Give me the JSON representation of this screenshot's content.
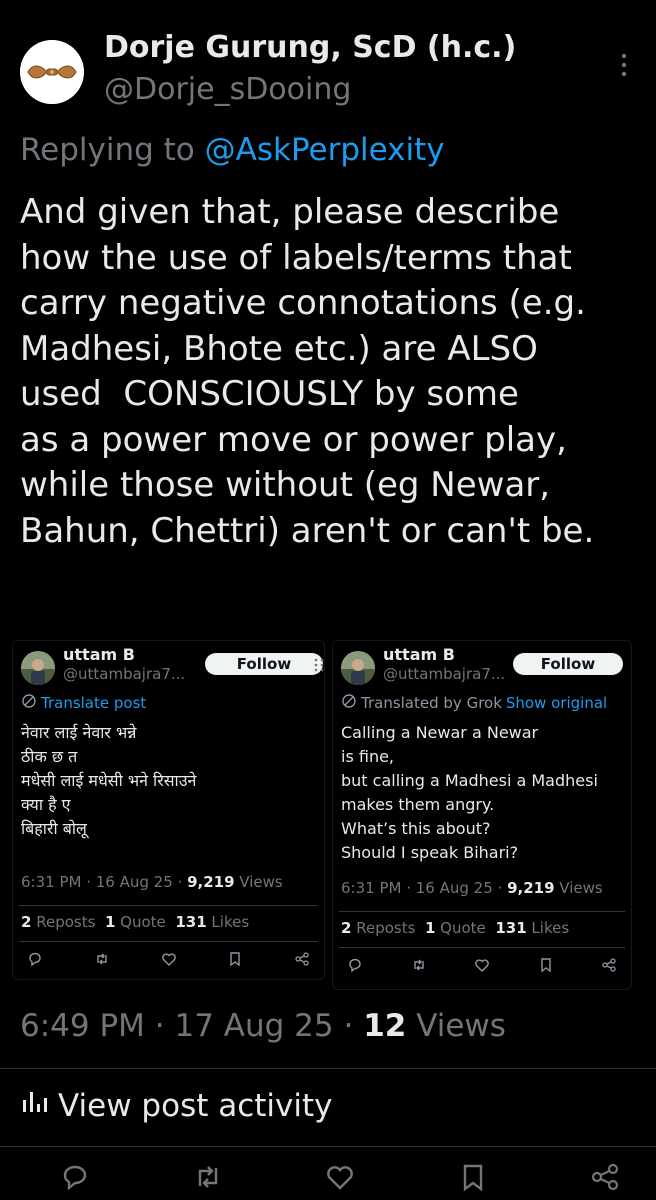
{
  "post": {
    "author_name": "Dorje Gurung, ScD (h.c.)",
    "author_handle": "@Dorje_sDooing",
    "replying_prefix": "Replying to",
    "replying_to": "@AskPerplexity",
    "body_lines": [
      "And given that, please describe",
      "how the use of labels/terms that",
      "carry negative connotations (e.g.",
      "Madhesi, Bhote etc.) are ALSO",
      "used  CONSCIOUSLY by some",
      "as a power move or power play,",
      "while those without (eg Newar,",
      "Bahun, Chettri) aren't or can't be."
    ],
    "time": "6:49 PM",
    "date": "17 Aug 25",
    "views_count": "12",
    "views_label": "Views",
    "activity_label": "View post activity"
  },
  "embedded": [
    {
      "name": "uttam B",
      "handle": "@uttambajra7...",
      "follow_label": "Follow",
      "translate_text": "Translate post",
      "body_lines": [
        "नेवार लाई नेवार भन्ने",
        "ठीक छ त",
        "मधेसी लाई मधेसी भने रिसाउने",
        "क्या है ए",
        "बिहारी बोलू"
      ],
      "time_date": "6:31 PM · 16 Aug 25 · ",
      "views_count": "9,219",
      "views_label": " Views",
      "reposts_count": "2",
      "reposts_label": "Reposts",
      "quotes_count": "1",
      "quotes_label": "Quote",
      "likes_count": "131",
      "likes_label": "Likes"
    },
    {
      "name": "uttam B",
      "handle": "@uttambajra7...",
      "follow_label": "Follow",
      "translated_text": "Translated by Grok",
      "show_original": "Show original",
      "body_lines": [
        "Calling a Newar a Newar",
        "is fine,",
        "but calling a Madhesi a Madhesi",
        "makes them angry.",
        "What’s this about?",
        "Should I speak Bihari?"
      ],
      "time_date": "6:31 PM · 16 Aug 25 · ",
      "views_count": "9,219",
      "views_label": " Views",
      "reposts_count": "2",
      "reposts_label": "Reposts",
      "quotes_count": "1",
      "quotes_label": "Quote",
      "likes_count": "131",
      "likes_label": "Likes"
    }
  ],
  "icons": {
    "more": "more-vertical-icon",
    "translate": "translate-icon",
    "reply": "reply-icon",
    "repost": "repost-icon",
    "like": "heart-icon",
    "bookmark": "bookmark-icon",
    "share": "share-icon",
    "activity": "bar-chart-icon"
  },
  "colors": {
    "background": "#000000",
    "text": "#e7e9ea",
    "muted": "#71767b",
    "accent": "#1d9bf0"
  }
}
